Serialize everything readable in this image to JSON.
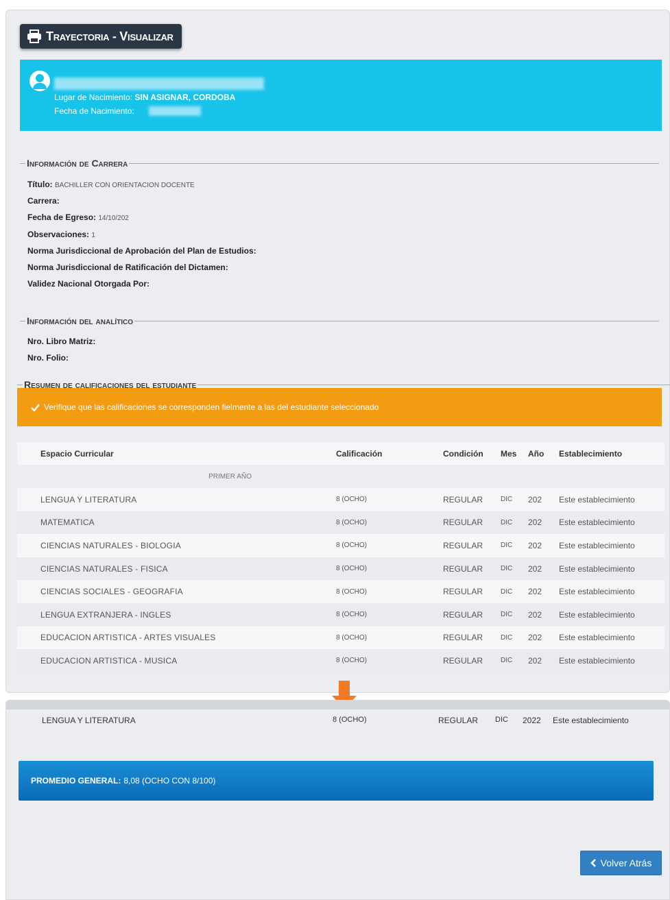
{
  "header": {
    "title": "Trayectoria - Visualizar",
    "icon": "print-icon"
  },
  "student": {
    "birthplace_label": "Lugar de Nacimiento:",
    "birthplace_value": "SIN ASIGNAR, CORDOBA",
    "birthdate_label": "Fecha de Nacimiento:"
  },
  "career_section": {
    "legend": "Información de Carrera",
    "titulo_label": "Título:",
    "titulo_value": "BACHILLER CON ORIENTACION DOCENTE",
    "carrera_label": "Carrera:",
    "egreso_label": "Fecha de Egreso:",
    "egreso_value": "14/10/202",
    "obs_label": "Observaciones:",
    "obs_value": "1",
    "norma_aprob_label": "Norma Jurisdiccional de Aprobación del Plan de Estudios:",
    "norma_ratif_label": "Norma Jurisdiccional de Ratificación del Dictamen:",
    "validez_label": "Validez Nacional Otorgada Por:"
  },
  "analitico_section": {
    "legend": "Información del analítico",
    "libro_label": "Nro. Libro Matriz:",
    "folio_label": "Nro. Folio:"
  },
  "grades_section": {
    "legend": "Resumen de calificaciones del estudiante",
    "warning": "Verifique que las calificaciones se corresponden fielmente a las del estudiante seleccionado",
    "columns": [
      "Espacio Curricular",
      "Calificación",
      "Condición",
      "Mes",
      "Año",
      "Establecimiento"
    ],
    "group_label": "PRIMER AÑO",
    "rows": [
      {
        "subject": "LENGUA Y LITERATURA",
        "grade": "8 (OCHO)",
        "cond": "REGULAR",
        "mes": "DIC",
        "year": "202",
        "est": "Este establecimiento"
      },
      {
        "subject": "MATEMATICA",
        "grade": "8 (OCHO)",
        "cond": "REGULAR",
        "mes": "DIC",
        "year": "202",
        "est": "Este establecimiento"
      },
      {
        "subject": "CIENCIAS NATURALES - BIOLOGIA",
        "grade": "8 (OCHO)",
        "cond": "REGULAR",
        "mes": "DIC",
        "year": "202",
        "est": "Este establecimiento"
      },
      {
        "subject": "CIENCIAS NATURALES - FISICA",
        "grade": "8 (OCHO)",
        "cond": "REGULAR",
        "mes": "DIC",
        "year": "202",
        "est": "Este establecimiento"
      },
      {
        "subject": "CIENCIAS SOCIALES - GEOGRAFIA",
        "grade": "8 (OCHO)",
        "cond": "REGULAR",
        "mes": "DIC",
        "year": "202",
        "est": "Este establecimiento"
      },
      {
        "subject": "LENGUA EXTRANJERA - INGLES",
        "grade": "8 (OCHO)",
        "cond": "REGULAR",
        "mes": "DIC",
        "year": "202",
        "est": "Este establecimiento"
      },
      {
        "subject": "EDUCACION ARTISTICA - ARTES VISUALES",
        "grade": "8 (OCHO)",
        "cond": "REGULAR",
        "mes": "DIC",
        "year": "202",
        "est": "Este establecimiento"
      },
      {
        "subject": "EDUCACION ARTISTICA - MUSICA",
        "grade": "8 (OCHO)",
        "cond": "REGULAR",
        "mes": "DIC",
        "year": "202",
        "est": "Este establecimiento"
      }
    ]
  },
  "zoom_row": {
    "subject": "LENGUA Y LITERATURA",
    "grade": "8 (OCHO)",
    "cond": "REGULAR",
    "mes": "DIC",
    "year": "2022",
    "est": "Este establecimiento"
  },
  "average": {
    "label": "PROMEDIO GENERAL:",
    "value": "8,08 (OCHO CON 8/100)"
  },
  "back_button": {
    "label": "Volver Atrás",
    "icon": "chevron-left-icon"
  },
  "colors": {
    "info_box": "#18c3ea",
    "warning": "#f39c12",
    "average": "#1a8fd6",
    "back_button": "#3280c4",
    "arrow": "#f07a26"
  }
}
